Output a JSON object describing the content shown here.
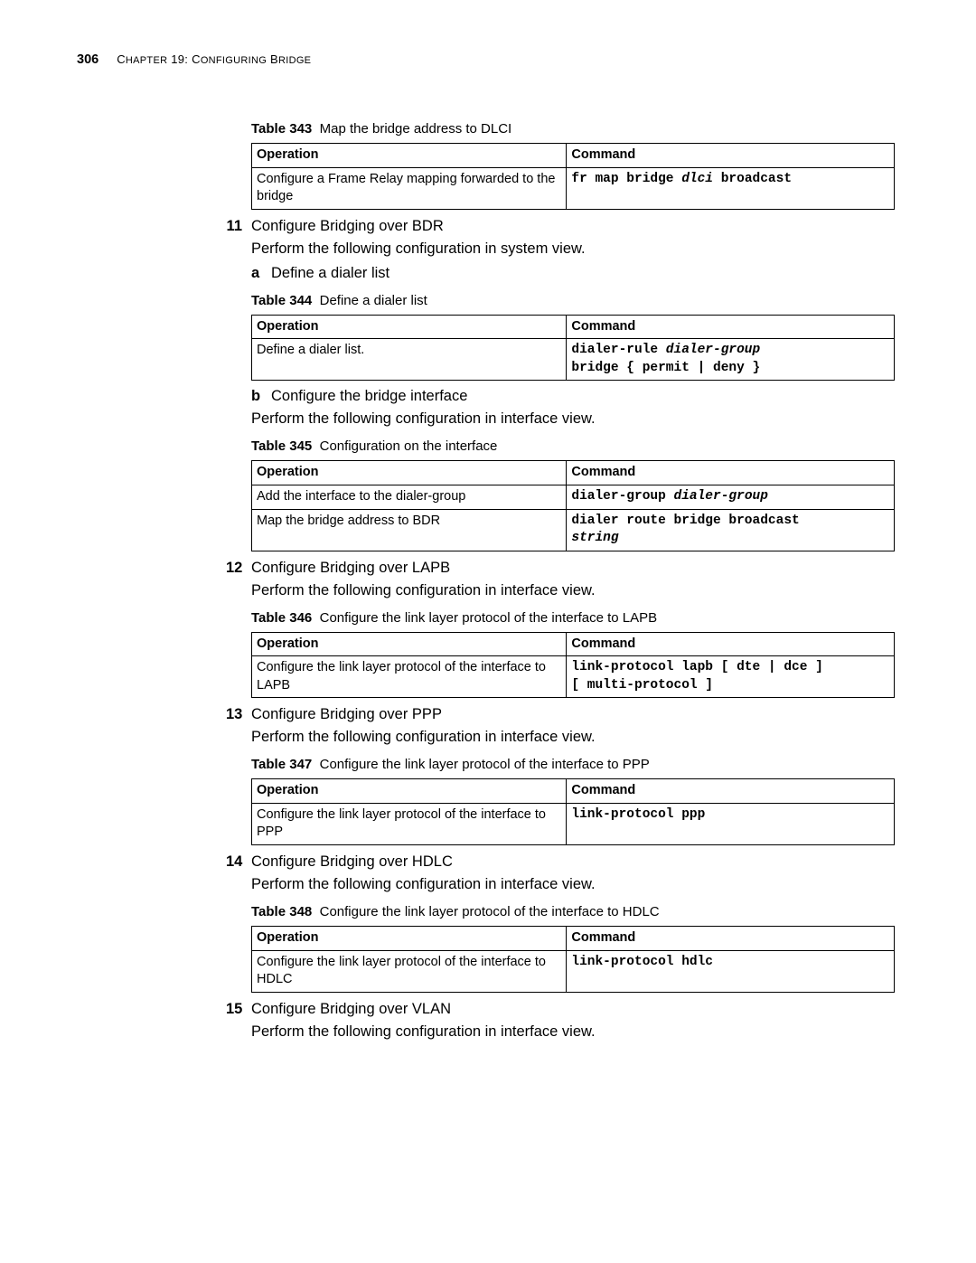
{
  "page_number": "306",
  "chapter_label_prefix": "C",
  "chapter_label_rest_2": "HAPTER",
  "chapter_num": " 19: C",
  "chapter_label_rest": "ONFIGURING",
  "chapter_label_b": " B",
  "chapter_label_end": "RIDGE",
  "tables": {
    "t343": {
      "label": "Table 343",
      "caption": "Map the bridge address to DLCI",
      "headers": {
        "op": "Operation",
        "cmd": "Command"
      },
      "row1": {
        "op": "Configure a Frame Relay mapping forwarded to the bridge",
        "cmd_pre": "fr map bridge ",
        "cmd_em": "dlci",
        "cmd_post": " broadcast"
      }
    },
    "t344": {
      "label": "Table 344",
      "caption": "Define a dialer list",
      "headers": {
        "op": "Operation",
        "cmd": "Command"
      },
      "row1": {
        "op": "Define a dialer list.",
        "cmd_l1_pre": "dialer-rule ",
        "cmd_l1_em": "dialer-group",
        "cmd_l2": "bridge { permit | deny }"
      }
    },
    "t345": {
      "label": "Table 345",
      "caption": "Configuration on the interface",
      "headers": {
        "op": "Operation",
        "cmd": "Command"
      },
      "row1": {
        "op": "Add the interface to the dialer-group",
        "cmd_pre": "dialer-group ",
        "cmd_em": "dialer-group"
      },
      "row2": {
        "op": "Map the bridge address to BDR",
        "cmd_l1": "dialer route bridge broadcast",
        "cmd_em": "string"
      }
    },
    "t346": {
      "label": "Table 346",
      "caption": "Configure the link layer protocol of the interface to LAPB",
      "headers": {
        "op": "Operation",
        "cmd": "Command"
      },
      "row1": {
        "op": "Configure the link layer protocol of the interface to LAPB",
        "cmd_l1": "link-protocol lapb [ dte | dce ]",
        "cmd_l2": "[ multi-protocol ]"
      }
    },
    "t347": {
      "label": "Table 347",
      "caption": "Configure the link layer protocol of the interface to PPP",
      "headers": {
        "op": "Operation",
        "cmd": "Command"
      },
      "row1": {
        "op": "Configure the link layer protocol of the interface to PPP",
        "cmd": "link-protocol ppp"
      }
    },
    "t348": {
      "label": "Table 348",
      "caption": "Configure the link layer protocol of the interface to HDLC",
      "headers": {
        "op": "Operation",
        "cmd": "Command"
      },
      "row1": {
        "op": "Configure the link layer protocol of the interface to HDLC",
        "cmd": "link-protocol hdlc"
      }
    }
  },
  "steps": {
    "s11": {
      "num": "11",
      "title": "Configure Bridging over BDR",
      "desc": "Perform the following configuration in system view."
    },
    "s11a": {
      "sub": "a",
      "title": "Define a dialer list"
    },
    "s11b": {
      "sub": "b",
      "title": "Configure the bridge interface",
      "desc": "Perform the following configuration in interface view."
    },
    "s12": {
      "num": "12",
      "title": "Configure Bridging over LAPB",
      "desc": "Perform the following configuration in interface view."
    },
    "s13": {
      "num": "13",
      "title": "Configure Bridging over PPP",
      "desc": "Perform the following configuration in interface view."
    },
    "s14": {
      "num": "14",
      "title": "Configure Bridging over HDLC",
      "desc": "Perform the following configuration in interface view."
    },
    "s15": {
      "num": "15",
      "title": "Configure Bridging over VLAN",
      "desc": "Perform the following configuration in interface view."
    }
  }
}
